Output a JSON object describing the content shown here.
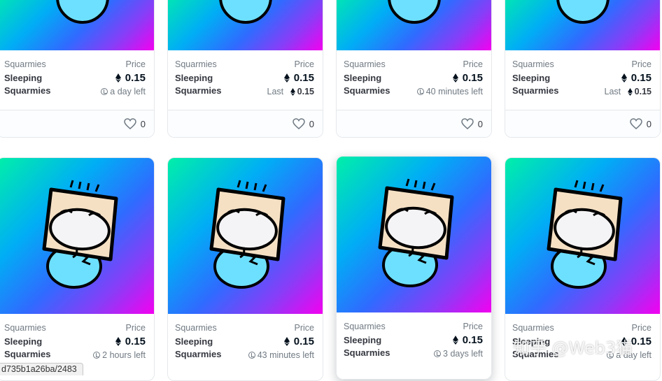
{
  "grid": {
    "rows": [
      {
        "cards": [
          {
            "collection": "Squarmies",
            "title": "Sleeping Squarmies",
            "price_label": "Price",
            "price": "0.15",
            "sub_type": "time",
            "sub_label": "",
            "sub_value": "a day left",
            "likes": "0"
          },
          {
            "collection": "Squarmies",
            "title": "Sleeping Squarmies",
            "price_label": "Price",
            "price": "0.15",
            "sub_type": "last",
            "sub_label": "Last",
            "sub_value": "0.15",
            "likes": "0"
          },
          {
            "collection": "Squarmies",
            "title": "Sleeping Squarmies",
            "price_label": "Price",
            "price": "0.15",
            "sub_type": "time",
            "sub_label": "",
            "sub_value": "40 minutes left",
            "likes": "0"
          },
          {
            "collection": "Squarmies",
            "title": "Sleeping Squarmies",
            "price_label": "Price",
            "price": "0.15",
            "sub_type": "last",
            "sub_label": "Last",
            "sub_value": "0.15",
            "likes": "0"
          }
        ]
      },
      {
        "cards": [
          {
            "collection": "Squarmies",
            "title": "Sleeping Squarmies",
            "price_label": "Price",
            "price": "0.15",
            "sub_type": "time",
            "sub_label": "",
            "sub_value": "2 hours left"
          },
          {
            "collection": "Squarmies",
            "title": "Sleeping Squarmies",
            "price_label": "Price",
            "price": "0.15",
            "sub_type": "time",
            "sub_label": "",
            "sub_value": "43 minutes left"
          },
          {
            "collection": "Squarmies",
            "title": "Sleeping Squarmies",
            "price_label": "Price",
            "price": "0.15",
            "sub_type": "time",
            "sub_label": "",
            "sub_value": "3 days left"
          },
          {
            "collection": "Squarmies",
            "title": "Sleeping Squarmies",
            "price_label": "Price",
            "price": "0.15",
            "sub_type": "time",
            "sub_label": "",
            "sub_value": "a day left"
          }
        ]
      }
    ]
  },
  "status_bar": {
    "url": "d735b1a26ba/2483"
  },
  "watermark": {
    "text": "知乎 @Web3猫"
  },
  "colors": {
    "gradient_start": "#00f0a8",
    "gradient_mid": "#2f6bff",
    "gradient_end": "#f400f0",
    "eth": "#04111d"
  },
  "icons": {
    "currency": "ethereum-icon",
    "favorite": "heart-icon",
    "timer": "clock-icon"
  }
}
